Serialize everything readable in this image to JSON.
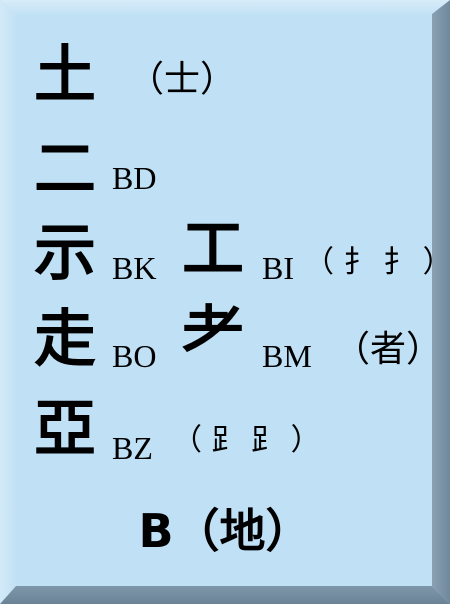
{
  "rows": [
    {
      "char": "土",
      "code": "",
      "variant": "（士）"
    },
    {
      "char": "二",
      "code": "BD",
      "variant": ""
    },
    {
      "char": "示",
      "code": "BK",
      "variant": ""
    },
    {
      "char": "走",
      "code": "BO",
      "variant": ""
    },
    {
      "char": "亞",
      "code": "BZ",
      "variant": "（ 𧾷 𧾷 ）"
    }
  ],
  "right_items": [
    {
      "char": "工",
      "code": "BI",
      "variant": "（ 扌 扌 ）"
    },
    {
      "char": "耂",
      "code": "BM",
      "variant": "（者）"
    }
  ],
  "footer": "B（地）",
  "colors": {
    "face": "#bfe0f5",
    "bevel_dark": "#7e97ab",
    "text": "#000000"
  }
}
